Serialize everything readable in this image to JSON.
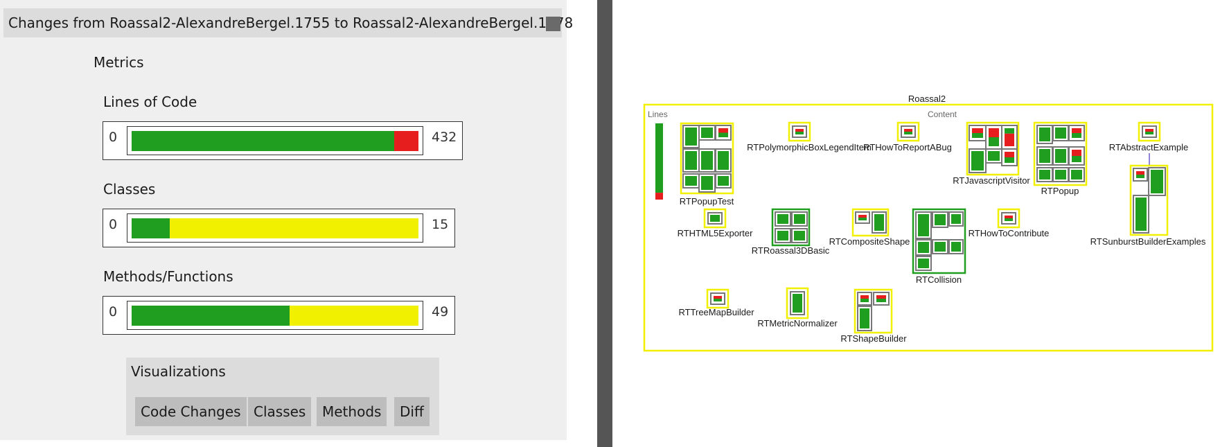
{
  "window": {
    "title": "Changes from Roassal2-AlexandreBergel.1755 to Roassal2-AlexandreBergel.1778"
  },
  "metrics": {
    "heading": "Metrics",
    "items": [
      {
        "label": "Lines of Code",
        "min": "0",
        "max": "432",
        "green_fraction": 0.915,
        "red_fraction": 0.085
      },
      {
        "label": "Classes",
        "min": "0",
        "max": "15",
        "green_fraction": 0.133,
        "red_fraction": 0
      },
      {
        "label": "Methods/Functions",
        "min": "0",
        "max": "49",
        "green_fraction": 0.55,
        "red_fraction": 0
      }
    ]
  },
  "visualizations": {
    "heading": "Visualizations",
    "buttons": [
      "Code Changes",
      "Classes",
      "Methods",
      "Diff"
    ]
  },
  "colors": {
    "added": "#1f9e1f",
    "removed": "#e61e1e",
    "unchanged": "#f0f000",
    "class_border": "#f0f000",
    "package_border": "#f0f000"
  },
  "visualization": {
    "package_name": "Roassal2",
    "lines_label": "Lines",
    "content_label": "Content",
    "lines_green_fraction": 0.91,
    "classes": [
      "RTPopupTest",
      "RTPolymorphicBoxLegendItem",
      "RTHowToReportABug",
      "RTJavascriptVisitor",
      "RTPopup",
      "RTAbstractExample",
      "RTHTML5Exporter",
      "RTRoassal3DBasic",
      "RTCompositeShape",
      "RTCollision",
      "RTHowToContribute",
      "RTSunburstBuilderExamples",
      "RTTreeMapBuilder",
      "RTMetricNormalizer",
      "RTShapeBuilder"
    ]
  }
}
